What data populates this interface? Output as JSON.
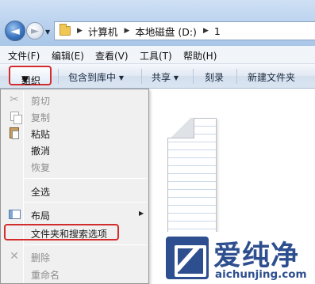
{
  "address_bar": {
    "breadcrumbs": [
      "计算机",
      "本地磁盘 (D:)",
      "1"
    ],
    "separator": "▶",
    "back_icon": "back-arrow-icon",
    "forward_icon": "forward-arrow-icon",
    "folder_icon": "folder-icon"
  },
  "menubar": {
    "items": [
      "文件(F)",
      "编辑(E)",
      "查看(V)",
      "工具(T)",
      "帮助(H)"
    ]
  },
  "command_bar": {
    "organize": "组织",
    "include_in_library": "包含到库中",
    "share": "共享",
    "burn": "刻录",
    "new_folder": "新建文件夹",
    "dropdown_caret": "▼"
  },
  "organize_menu": {
    "items": [
      {
        "label": "剪切",
        "enabled": false,
        "icon": "scissors-icon"
      },
      {
        "label": "复制",
        "enabled": false,
        "icon": "copy-icon"
      },
      {
        "label": "粘贴",
        "enabled": true,
        "icon": "paste-icon"
      },
      {
        "label": "撤消",
        "enabled": true,
        "icon": ""
      },
      {
        "label": "恢复",
        "enabled": false,
        "icon": ""
      },
      {
        "label": "全选",
        "enabled": true,
        "icon": ""
      },
      {
        "label": "布局",
        "enabled": true,
        "icon": "layout-icon",
        "submenu": true
      },
      {
        "label": "文件夹和搜索选项",
        "enabled": true,
        "icon": "",
        "highlighted": true
      },
      {
        "label": "删除",
        "enabled": false,
        "icon": "delete-icon"
      },
      {
        "label": "重命名",
        "enabled": false,
        "icon": ""
      }
    ],
    "submenu_arrow": "▶"
  },
  "watermark": {
    "title": "爱纯净",
    "url": "aichunjing.com"
  },
  "colors": {
    "highlight_border": "#d32c2c",
    "watermark_blue": "#2e4f8f",
    "disabled_text": "#8d8d8d"
  }
}
